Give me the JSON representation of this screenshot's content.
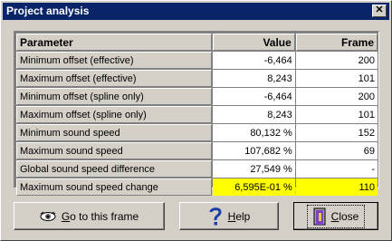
{
  "window": {
    "title": "Project analysis",
    "close_glyph": "✕"
  },
  "table": {
    "headers": [
      "Parameter",
      "Value",
      "Frame"
    ],
    "rows": [
      {
        "param": "Minimum offset (effective)",
        "value": "-6,464",
        "frame": "200"
      },
      {
        "param": "Maximum offset (effective)",
        "value": "8,243",
        "frame": "101"
      },
      {
        "param": "Minimum offset (spline only)",
        "value": "-6,464",
        "frame": "200"
      },
      {
        "param": "Maximum offset (spline only)",
        "value": "8,243",
        "frame": "101"
      },
      {
        "param": "Minimum sound speed",
        "value": "80,132 %",
        "frame": "152"
      },
      {
        "param": "Maximum sound speed",
        "value": "107,682 %",
        "frame": "69"
      },
      {
        "param": "Global sound speed difference",
        "value": "27,549 %",
        "frame": "-"
      },
      {
        "param": "Maximum sound speed change",
        "value": "6,595E-01 %",
        "frame": "110",
        "highlight": true
      }
    ]
  },
  "buttons": {
    "goto": {
      "prefix": "G",
      "rest": "o to this frame",
      "icon": "eye-icon"
    },
    "help": {
      "prefix": "H",
      "rest": "elp",
      "icon": "question-mark-icon"
    },
    "close": {
      "prefix": "C",
      "rest": "lose",
      "icon": "door-exit-icon"
    }
  },
  "colors": {
    "titlebar": "#0a246a",
    "highlight": "#ffff00",
    "face": "#d4d0c8"
  }
}
